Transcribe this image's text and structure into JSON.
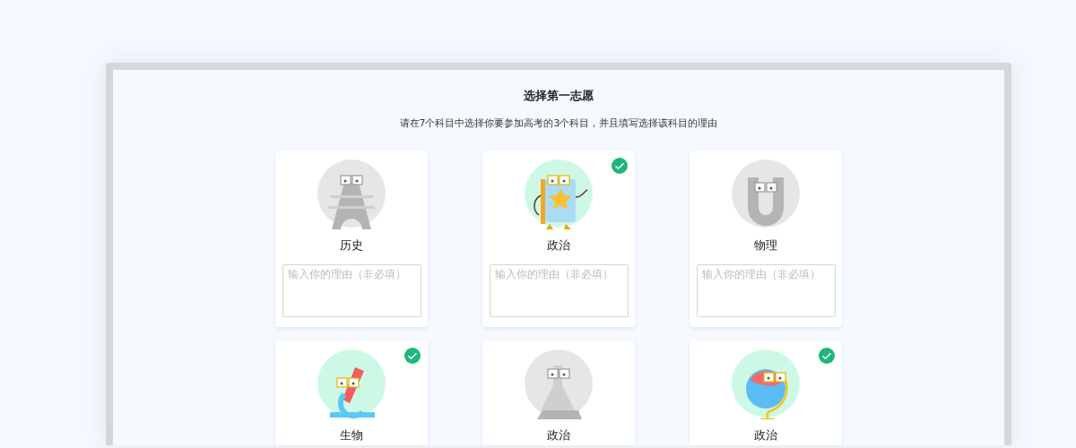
{
  "header": {
    "title": "选择第一志愿",
    "subtitle": "请在7个科目中选择你要参加高考的3个科目，并且填写选择该科目的理由"
  },
  "cards": [
    {
      "kind": "tower",
      "label": "历史",
      "selected": false,
      "placeholder": "输入你的理由（非必填）"
    },
    {
      "kind": "book",
      "label": "政治",
      "selected": true,
      "placeholder": "输入你的理由（非必填）"
    },
    {
      "kind": "magnet",
      "label": "物理",
      "selected": false,
      "placeholder": "输入你的理由（非必填）"
    },
    {
      "kind": "microscope",
      "label": "生物",
      "selected": true
    },
    {
      "kind": "flask",
      "label": "政治",
      "selected": false
    },
    {
      "kind": "globe",
      "label": "政治",
      "selected": true
    }
  ]
}
